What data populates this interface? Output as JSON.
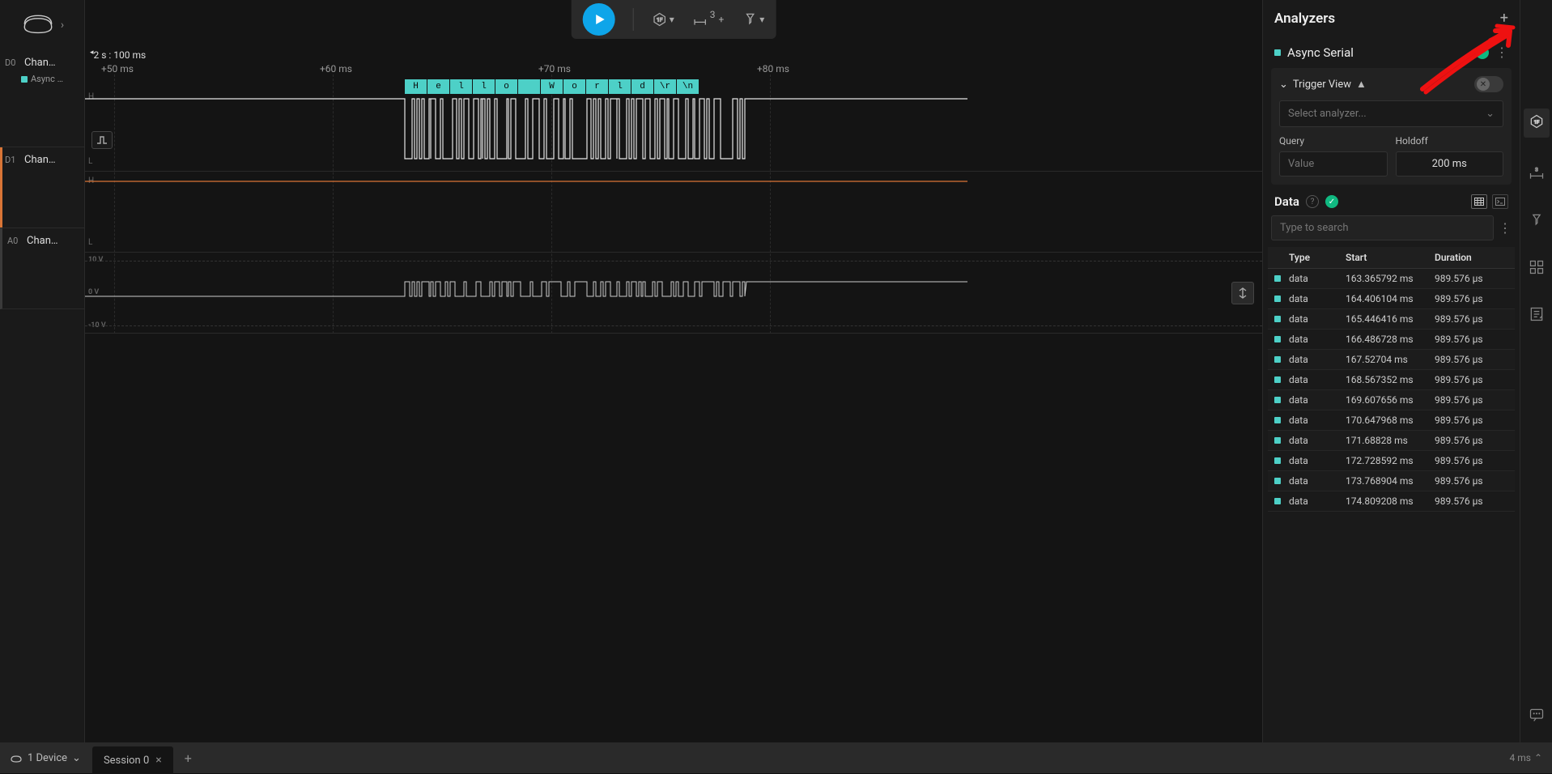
{
  "toolbar": {
    "timing_badge_count": "3"
  },
  "timeline": {
    "header": "2 s : 100 ms",
    "ticks": [
      {
        "label": "+50 ms",
        "pos": 20
      },
      {
        "label": "+60 ms",
        "pos": 290
      },
      {
        "label": "+70 ms",
        "pos": 560
      },
      {
        "label": "+80 ms",
        "pos": 830
      }
    ]
  },
  "channels": {
    "d0": {
      "idx": "D0",
      "name": "Chan…",
      "analyzer_tag": "Async …",
      "hi": "H",
      "lo": "L"
    },
    "d1": {
      "idx": "D1",
      "name": "Chan…",
      "hi": "H",
      "lo": "L"
    },
    "a0": {
      "idx": "A0",
      "name": "Chan…",
      "v_hi": "10 V",
      "v_mid": "0 V",
      "v_lo": "-10 V"
    }
  },
  "decoded_bytes": [
    "H",
    "e",
    "l",
    "l",
    "o",
    "",
    "W",
    "o",
    "r",
    "l",
    "d",
    "\\r",
    "\\n"
  ],
  "analyzers": {
    "title": "Analyzers",
    "items": [
      {
        "name": "Async Serial",
        "status": "ok"
      }
    ],
    "trigger_view": {
      "title": "Trigger View",
      "select_placeholder": "Select analyzer...",
      "query_label": "Query",
      "query_placeholder": "Value",
      "holdoff_label": "Holdoff",
      "holdoff_value": "200 ms"
    }
  },
  "data_section": {
    "title": "Data",
    "search_placeholder": "Type to search",
    "columns": [
      "Type",
      "Start",
      "Duration"
    ],
    "rows": [
      {
        "type": "data",
        "start": "163.365792 ms",
        "duration": "989.576 µs"
      },
      {
        "type": "data",
        "start": "164.406104 ms",
        "duration": "989.576 µs"
      },
      {
        "type": "data",
        "start": "165.446416 ms",
        "duration": "989.576 µs"
      },
      {
        "type": "data",
        "start": "166.486728 ms",
        "duration": "989.576 µs"
      },
      {
        "type": "data",
        "start": "167.52704 ms",
        "duration": "989.576 µs"
      },
      {
        "type": "data",
        "start": "168.567352 ms",
        "duration": "989.576 µs"
      },
      {
        "type": "data",
        "start": "169.607656 ms",
        "duration": "989.576 µs"
      },
      {
        "type": "data",
        "start": "170.647968 ms",
        "duration": "989.576 µs"
      },
      {
        "type": "data",
        "start": "171.68828 ms",
        "duration": "989.576 µs"
      },
      {
        "type": "data",
        "start": "172.728592 ms",
        "duration": "989.576 µs"
      },
      {
        "type": "data",
        "start": "173.768904 ms",
        "duration": "989.576 µs"
      },
      {
        "type": "data",
        "start": "174.809208 ms",
        "duration": "989.576 µs"
      }
    ]
  },
  "status_bar": {
    "device_count": "1 Device",
    "session_name": "Session 0",
    "right_text": "4 ms"
  }
}
